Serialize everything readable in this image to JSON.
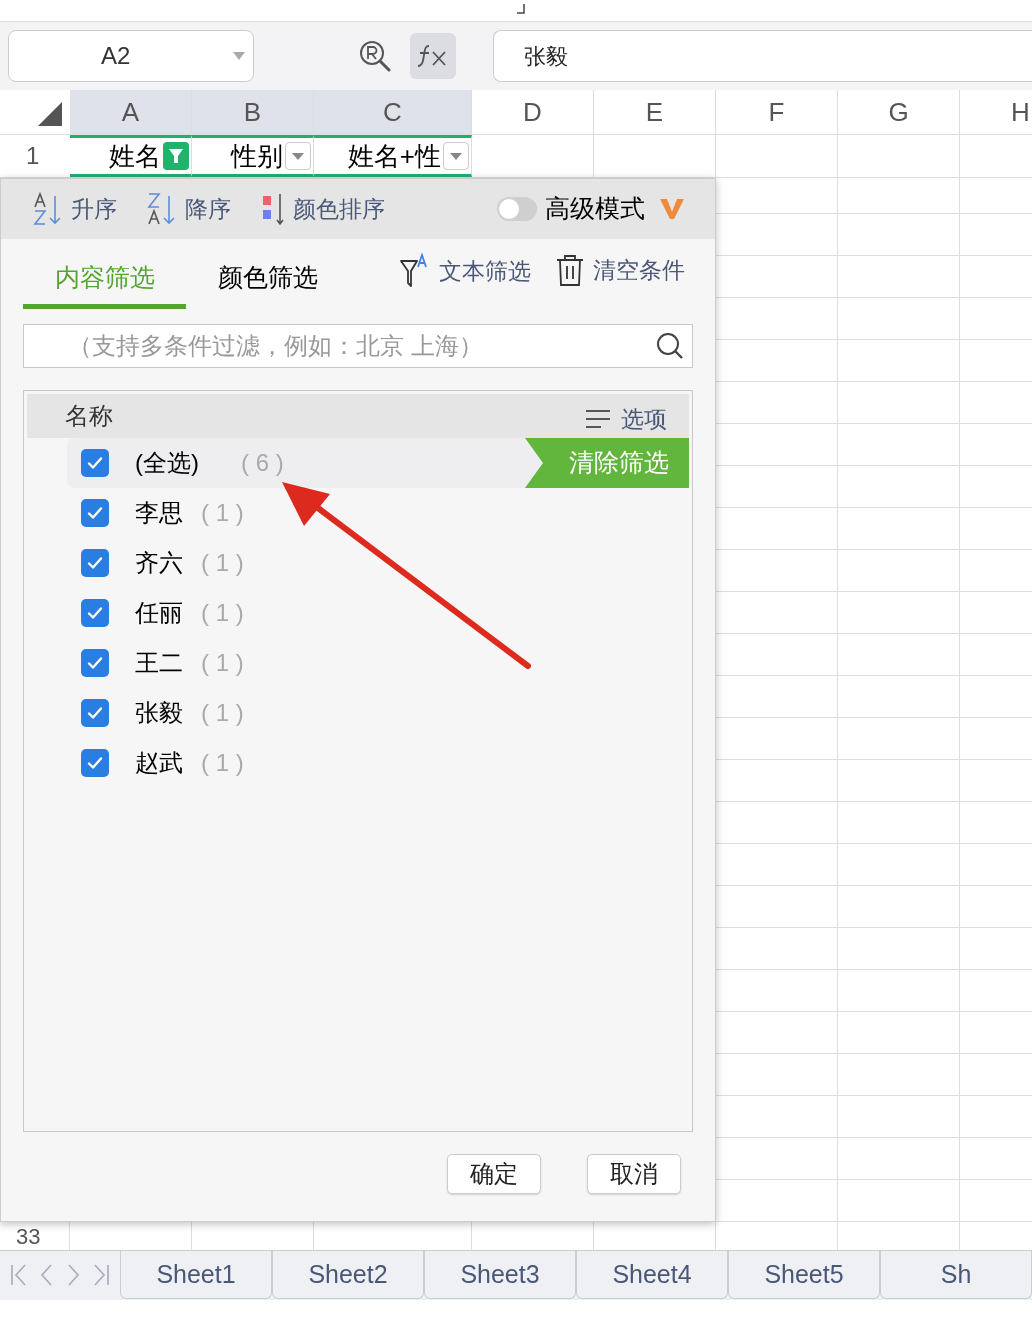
{
  "name_box": {
    "value": "A2"
  },
  "formula_bar": {
    "value": "张毅"
  },
  "columns": [
    {
      "label": "A",
      "selected": true
    },
    {
      "label": "B",
      "selected": true
    },
    {
      "label": "C",
      "selected": true
    },
    {
      "label": "D",
      "selected": false
    },
    {
      "label": "E",
      "selected": false
    },
    {
      "label": "F",
      "selected": false
    },
    {
      "label": "G",
      "selected": false
    },
    {
      "label": "H",
      "selected": false
    }
  ],
  "header_row": {
    "number": "1",
    "cells": [
      {
        "text": "姓名",
        "filter_active": true
      },
      {
        "text": "性别",
        "filter_active": false
      },
      {
        "text": "姓名+性",
        "filter_active": false
      }
    ]
  },
  "filter_panel": {
    "sort_buttons": [
      {
        "kind": "ascending",
        "label": "升序"
      },
      {
        "kind": "descending",
        "label": "降序"
      },
      {
        "kind": "color",
        "label": "颜色排序"
      }
    ],
    "advanced_mode": {
      "label": "高级模式",
      "on": false
    },
    "tabs": [
      {
        "label": "内容筛选",
        "selected": true
      },
      {
        "label": "颜色筛选",
        "selected": false
      }
    ],
    "actions": [
      {
        "kind": "text_filter",
        "label": "文本筛选"
      },
      {
        "kind": "clear",
        "label": "清空条件"
      }
    ],
    "search": {
      "placeholder": "（支持多条件过滤，例如：北京  上海）"
    },
    "list_header": {
      "title": "名称",
      "options": "选项"
    },
    "items": [
      {
        "kind": "all",
        "label": "(全选)",
        "count": "( 6 )",
        "checked": true
      },
      {
        "kind": "value",
        "label": "李思",
        "count": "( 1 )",
        "checked": true
      },
      {
        "kind": "value",
        "label": "齐六",
        "count": "( 1 )",
        "checked": true
      },
      {
        "kind": "value",
        "label": "任丽",
        "count": "( 1 )",
        "checked": true
      },
      {
        "kind": "value",
        "label": "王二",
        "count": "( 1 )",
        "checked": true
      },
      {
        "kind": "value",
        "label": "张毅",
        "count": "( 1 )",
        "checked": true
      },
      {
        "kind": "value",
        "label": "赵武",
        "count": "( 1 )",
        "checked": true
      }
    ],
    "clear_button": "清除筛选",
    "buttons": [
      "确定",
      "取消"
    ]
  },
  "last_row_number": "33",
  "sheet_tabs": [
    "Sheet1",
    "Sheet2",
    "Sheet3",
    "Sheet4",
    "Sheet5",
    "Sh"
  ]
}
